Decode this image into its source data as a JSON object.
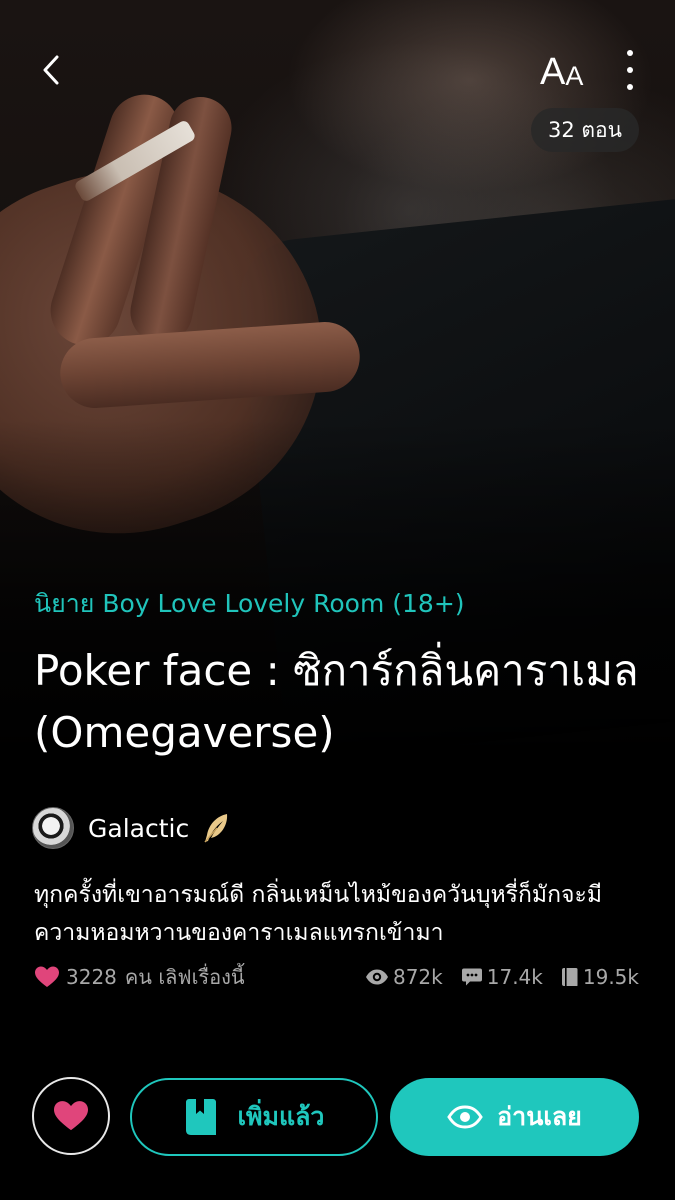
{
  "header": {
    "back_icon": "chevron-left-icon",
    "font_size_big": "A",
    "font_size_small": "A",
    "more_icon": "more-vertical-icon",
    "episodes_badge": "32 ตอน"
  },
  "novel": {
    "category": "นิยาย Boy Love Lovely Room (18+)",
    "title": "Poker face : ซิการ์กลิ่นคาราเมล (Omegaverse)",
    "author": "Galactic",
    "author_badge_icon": "feather-icon",
    "synopsis": "ทุกครั้งที่เขาอารมณ์ดี กลิ่นเหม็นไหม้ของควันบุหรี่ก็มักจะมีความหอมหวานของคาราเมลแทรกเข้ามา"
  },
  "stats": {
    "likes_count": "3228",
    "likes_label": "คน เลิฟเรื่องนี้",
    "views": "872k",
    "comments": "17.4k",
    "bookmarks": "19.5k"
  },
  "actions": {
    "added_label": "เพิ่มแล้ว",
    "read_label": "อ่านเลย"
  },
  "colors": {
    "accent": "#1fc7bd",
    "heart": "#e0457b",
    "background": "#000000"
  }
}
